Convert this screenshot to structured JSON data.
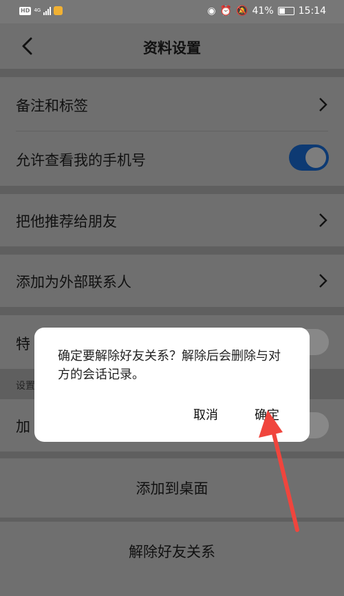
{
  "status_bar": {
    "hd": "HD",
    "network": "4G",
    "battery": "41%",
    "time": "15:14"
  },
  "header": {
    "title": "资料设置"
  },
  "rows": {
    "remark_tags": "备注和标签",
    "allow_phone": "允许查看我的手机号",
    "recommend": "把他推荐给朋友",
    "add_external": "添加为外部联系人",
    "special_partial": "特",
    "settings_note_partial": "设置",
    "add_partial": "加",
    "add_to_desktop": "添加到桌面",
    "remove_friend": "解除好友关系"
  },
  "dialog": {
    "message": "确定要解除好友关系？解除后会删除与对方的会话记录。",
    "cancel_label": "取消",
    "confirm_label": "确定"
  },
  "colors": {
    "overlay_gray": "#6f6f6f",
    "toggle_on": "#0d3a73",
    "arrow_red": "#f0453d",
    "dialog_bg": "#ffffff"
  }
}
